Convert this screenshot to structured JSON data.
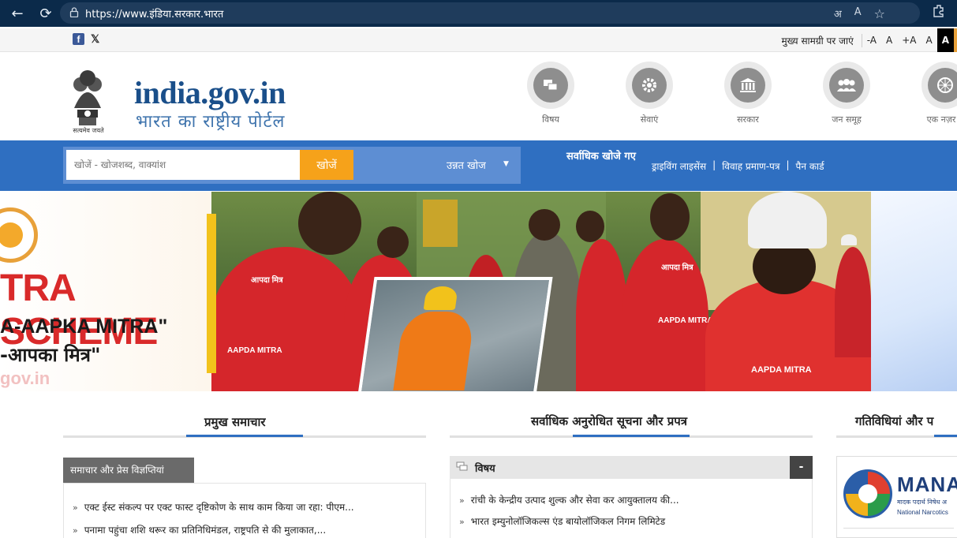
{
  "browser": {
    "url": "https://www.इंडिया.सरकार.भारत",
    "back_icon": "←",
    "reload_icon": "⟳",
    "lock_icon": "🔒",
    "read_aloud_icon": "अ",
    "text_size_icon": "A",
    "favorite_icon": "☆",
    "extensions_icon": "⚙"
  },
  "utility": {
    "skip_label": "मुख्य सामग्री पर जाएं",
    "font_minus": "-A",
    "font_normal": "A",
    "font_plus": "+A",
    "contrast_light": "A",
    "contrast_dark": "A"
  },
  "header": {
    "emblem_caption": "सत्यमेव जयते",
    "site_title": "india.gov.in",
    "site_subtitle": "भारत का राष्ट्रीय पोर्टल",
    "nav": [
      {
        "label": "विषय",
        "icon": "topics-icon"
      },
      {
        "label": "सेवाएं",
        "icon": "services-icon"
      },
      {
        "label": "सरकार",
        "icon": "government-icon"
      },
      {
        "label": "जन समूह",
        "icon": "people-icon"
      },
      {
        "label": "एक नज़र में",
        "icon": "at-a-glance-icon"
      }
    ]
  },
  "search": {
    "placeholder": "खोजें - खोजशब्द, वाक्यांश",
    "button_label": "खोजें",
    "advanced_label": "उन्नत खोज",
    "most_searched_label": "सर्वाधिक खोजे गए",
    "quick_links": [
      "ड्राइविंग लाइसेंस",
      "विवाह प्रमाण-पत्र",
      "पैन कार्ड"
    ]
  },
  "banner": {
    "scheme_text": "TRA SCHEME",
    "tagline1": "A-AAPKA MITRA\"",
    "tagline2": "-आपका मित्र\"",
    "domain_text": "gov.in",
    "jacket_text_en": "AAPDA MITRA",
    "jacket_text_hi": "आपदा मित्र"
  },
  "sections": {
    "news": {
      "title": "प्रमुख समाचार",
      "tab_label": "समाचार और प्रेस विज्ञप्तियां",
      "items": [
        "एक्ट ईस्ट संकल्प पर एक्ट फास्ट दृष्टिकोण के साथ काम किया जा रहा: पीएम...",
        "पनामा पहुंचा शशि थरूर का प्रतिनिधिमंडल, राष्ट्रपति से की मुलाकात,..."
      ]
    },
    "requested": {
      "title": "सर्वाधिक अनुरोधित सूचना और प्रपत्र",
      "panel_label": "विषय",
      "toggle_label": "-",
      "items": [
        "रांची के केन्द्रीय उत्पाद शुल्क और सेवा कर आयुक्तालय की...",
        "भारत इम्युनोलॉजिकल्स एंड बायोलॉजिकल निगम लिमिटेड"
      ]
    },
    "activities": {
      "title": "गतिविधियां और प",
      "promo_title": "MANA",
      "promo_sub_hi": "मादक पदार्थ निषेध अ",
      "promo_sub_en": "National Narcotics"
    }
  },
  "colors": {
    "browser_bar": "#0b2a4a",
    "primary_blue": "#2f6fc1",
    "search_orange": "#f6a21a",
    "scheme_red": "#d92a2a",
    "banner_yellow": "#f2c21b"
  }
}
